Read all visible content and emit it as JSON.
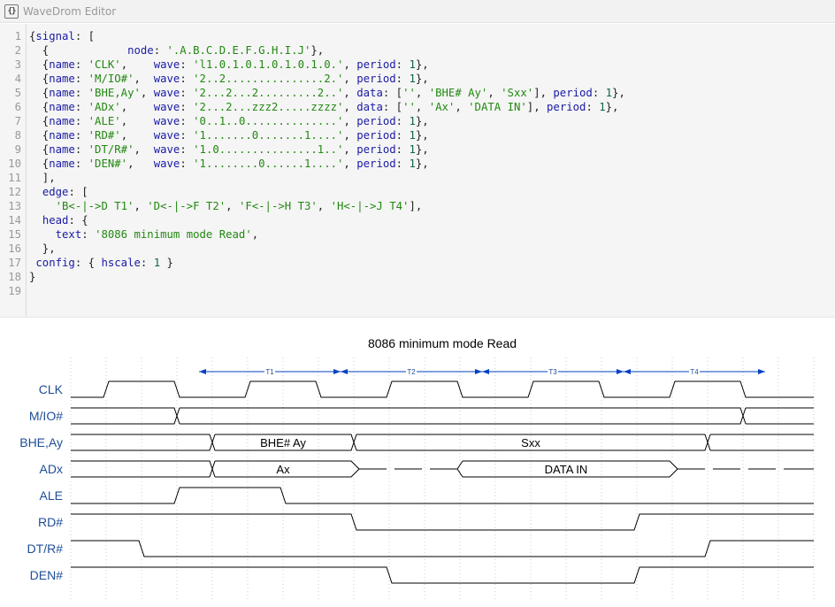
{
  "window": {
    "title": "WaveDrom Editor",
    "icon": "braces-icon"
  },
  "editor": {
    "line_numbers": [
      "1",
      "2",
      "3",
      "4",
      "5",
      "6",
      "7",
      "8",
      "9",
      "10",
      "11",
      "12",
      "13",
      "14",
      "15",
      "16",
      "17",
      "18",
      "19"
    ],
    "lines": [
      [
        {
          "t": "{",
          "c": "p"
        },
        {
          "t": "signal",
          "c": "key"
        },
        {
          "t": ": [",
          "c": "p"
        }
      ],
      [
        {
          "t": "  {            ",
          "c": "p"
        },
        {
          "t": "node",
          "c": "key"
        },
        {
          "t": ": ",
          "c": "p"
        },
        {
          "t": "'.A.B.C.D.E.F.G.H.I.J'",
          "c": "str"
        },
        {
          "t": "},",
          "c": "p"
        }
      ],
      [
        {
          "t": "  {",
          "c": "p"
        },
        {
          "t": "name",
          "c": "key"
        },
        {
          "t": ": ",
          "c": "p"
        },
        {
          "t": "'CLK'",
          "c": "str"
        },
        {
          "t": ",    ",
          "c": "p"
        },
        {
          "t": "wave",
          "c": "key"
        },
        {
          "t": ": ",
          "c": "p"
        },
        {
          "t": "'l1.0.1.0.1.0.1.0.1.0.'",
          "c": "str"
        },
        {
          "t": ", ",
          "c": "p"
        },
        {
          "t": "period",
          "c": "key"
        },
        {
          "t": ": ",
          "c": "p"
        },
        {
          "t": "1",
          "c": "num"
        },
        {
          "t": "},",
          "c": "p"
        }
      ],
      [
        {
          "t": "  {",
          "c": "p"
        },
        {
          "t": "name",
          "c": "key"
        },
        {
          "t": ": ",
          "c": "p"
        },
        {
          "t": "'M/IO#'",
          "c": "str"
        },
        {
          "t": ",  ",
          "c": "p"
        },
        {
          "t": "wave",
          "c": "key"
        },
        {
          "t": ": ",
          "c": "p"
        },
        {
          "t": "'2..2...............2.'",
          "c": "str"
        },
        {
          "t": ", ",
          "c": "p"
        },
        {
          "t": "period",
          "c": "key"
        },
        {
          "t": ": ",
          "c": "p"
        },
        {
          "t": "1",
          "c": "num"
        },
        {
          "t": "},",
          "c": "p"
        }
      ],
      [
        {
          "t": "  {",
          "c": "p"
        },
        {
          "t": "name",
          "c": "key"
        },
        {
          "t": ": ",
          "c": "p"
        },
        {
          "t": "'BHE,Ay'",
          "c": "str"
        },
        {
          "t": ", ",
          "c": "p"
        },
        {
          "t": "wave",
          "c": "key"
        },
        {
          "t": ": ",
          "c": "p"
        },
        {
          "t": "'2...2...2.........2..'",
          "c": "str"
        },
        {
          "t": ", ",
          "c": "p"
        },
        {
          "t": "data",
          "c": "key"
        },
        {
          "t": ": [",
          "c": "p"
        },
        {
          "t": "''",
          "c": "str"
        },
        {
          "t": ", ",
          "c": "p"
        },
        {
          "t": "'BHE# Ay'",
          "c": "str"
        },
        {
          "t": ", ",
          "c": "p"
        },
        {
          "t": "'Sxx'",
          "c": "str"
        },
        {
          "t": "], ",
          "c": "p"
        },
        {
          "t": "period",
          "c": "key"
        },
        {
          "t": ": ",
          "c": "p"
        },
        {
          "t": "1",
          "c": "num"
        },
        {
          "t": "},",
          "c": "p"
        }
      ],
      [
        {
          "t": "  {",
          "c": "p"
        },
        {
          "t": "name",
          "c": "key"
        },
        {
          "t": ": ",
          "c": "p"
        },
        {
          "t": "'ADx'",
          "c": "str"
        },
        {
          "t": ",    ",
          "c": "p"
        },
        {
          "t": "wave",
          "c": "key"
        },
        {
          "t": ": ",
          "c": "p"
        },
        {
          "t": "'2...2...zzz2.....zzzz'",
          "c": "str"
        },
        {
          "t": ", ",
          "c": "p"
        },
        {
          "t": "data",
          "c": "key"
        },
        {
          "t": ": [",
          "c": "p"
        },
        {
          "t": "''",
          "c": "str"
        },
        {
          "t": ", ",
          "c": "p"
        },
        {
          "t": "'Ax'",
          "c": "str"
        },
        {
          "t": ", ",
          "c": "p"
        },
        {
          "t": "'DATA IN'",
          "c": "str"
        },
        {
          "t": "], ",
          "c": "p"
        },
        {
          "t": "period",
          "c": "key"
        },
        {
          "t": ": ",
          "c": "p"
        },
        {
          "t": "1",
          "c": "num"
        },
        {
          "t": "},",
          "c": "p"
        }
      ],
      [
        {
          "t": "  {",
          "c": "p"
        },
        {
          "t": "name",
          "c": "key"
        },
        {
          "t": ": ",
          "c": "p"
        },
        {
          "t": "'ALE'",
          "c": "str"
        },
        {
          "t": ",    ",
          "c": "p"
        },
        {
          "t": "wave",
          "c": "key"
        },
        {
          "t": ": ",
          "c": "p"
        },
        {
          "t": "'0..1..0..............'",
          "c": "str"
        },
        {
          "t": ", ",
          "c": "p"
        },
        {
          "t": "period",
          "c": "key"
        },
        {
          "t": ": ",
          "c": "p"
        },
        {
          "t": "1",
          "c": "num"
        },
        {
          "t": "},",
          "c": "p"
        }
      ],
      [
        {
          "t": "  {",
          "c": "p"
        },
        {
          "t": "name",
          "c": "key"
        },
        {
          "t": ": ",
          "c": "p"
        },
        {
          "t": "'RD#'",
          "c": "str"
        },
        {
          "t": ",    ",
          "c": "p"
        },
        {
          "t": "wave",
          "c": "key"
        },
        {
          "t": ": ",
          "c": "p"
        },
        {
          "t": "'1.......0.......1....'",
          "c": "str"
        },
        {
          "t": ", ",
          "c": "p"
        },
        {
          "t": "period",
          "c": "key"
        },
        {
          "t": ": ",
          "c": "p"
        },
        {
          "t": "1",
          "c": "num"
        },
        {
          "t": "},",
          "c": "p"
        }
      ],
      [
        {
          "t": "  {",
          "c": "p"
        },
        {
          "t": "name",
          "c": "key"
        },
        {
          "t": ": ",
          "c": "p"
        },
        {
          "t": "'DT/R#'",
          "c": "str"
        },
        {
          "t": ",  ",
          "c": "p"
        },
        {
          "t": "wave",
          "c": "key"
        },
        {
          "t": ": ",
          "c": "p"
        },
        {
          "t": "'1.0...............1..'",
          "c": "str"
        },
        {
          "t": ", ",
          "c": "p"
        },
        {
          "t": "period",
          "c": "key"
        },
        {
          "t": ": ",
          "c": "p"
        },
        {
          "t": "1",
          "c": "num"
        },
        {
          "t": "},",
          "c": "p"
        }
      ],
      [
        {
          "t": "  {",
          "c": "p"
        },
        {
          "t": "name",
          "c": "key"
        },
        {
          "t": ": ",
          "c": "p"
        },
        {
          "t": "'DEN#'",
          "c": "str"
        },
        {
          "t": ",   ",
          "c": "p"
        },
        {
          "t": "wave",
          "c": "key"
        },
        {
          "t": ": ",
          "c": "p"
        },
        {
          "t": "'1........0......1....'",
          "c": "str"
        },
        {
          "t": ", ",
          "c": "p"
        },
        {
          "t": "period",
          "c": "key"
        },
        {
          "t": ": ",
          "c": "p"
        },
        {
          "t": "1",
          "c": "num"
        },
        {
          "t": "},",
          "c": "p"
        }
      ],
      [
        {
          "t": "  ],",
          "c": "p"
        }
      ],
      [
        {
          "t": "  ",
          "c": "p"
        },
        {
          "t": "edge",
          "c": "key"
        },
        {
          "t": ": [",
          "c": "p"
        }
      ],
      [
        {
          "t": "    ",
          "c": "p"
        },
        {
          "t": "'B<-|->D T1'",
          "c": "str"
        },
        {
          "t": ", ",
          "c": "p"
        },
        {
          "t": "'D<-|->F T2'",
          "c": "str"
        },
        {
          "t": ", ",
          "c": "p"
        },
        {
          "t": "'F<-|->H T3'",
          "c": "str"
        },
        {
          "t": ", ",
          "c": "p"
        },
        {
          "t": "'H<-|->J T4'",
          "c": "str"
        },
        {
          "t": "],",
          "c": "p"
        }
      ],
      [
        {
          "t": "  ",
          "c": "p"
        },
        {
          "t": "head",
          "c": "key"
        },
        {
          "t": ": {",
          "c": "p"
        }
      ],
      [
        {
          "t": "    ",
          "c": "p"
        },
        {
          "t": "text",
          "c": "key"
        },
        {
          "t": ": ",
          "c": "p"
        },
        {
          "t": "'8086 minimum mode Read'",
          "c": "str"
        },
        {
          "t": ",",
          "c": "p"
        }
      ],
      [
        {
          "t": "  },",
          "c": "p"
        }
      ],
      [
        {
          "t": " ",
          "c": "p"
        },
        {
          "t": "config",
          "c": "key"
        },
        {
          "t": ": { ",
          "c": "p"
        },
        {
          "t": "hscale",
          "c": "key"
        },
        {
          "t": ": ",
          "c": "p"
        },
        {
          "t": "1",
          "c": "num"
        },
        {
          "t": " }",
          "c": "p"
        }
      ],
      [
        {
          "t": "}",
          "c": "p"
        }
      ],
      []
    ]
  },
  "diagram": {
    "title": "8086 minimum mode Read",
    "colors": {
      "wave": "#000000",
      "label": "#1f4e96",
      "edge": "#0041c4",
      "grid": "#cccccc",
      "title": "#000000"
    },
    "signals": [
      {
        "name": "CLK",
        "wave": "l1.0.1.0.1.0.1.0.1.0.",
        "data": []
      },
      {
        "name": "M/IO#",
        "wave": "2..2...............2.",
        "data": []
      },
      {
        "name": "BHE,Ay",
        "wave": "2...2...2.........2..",
        "data": [
          "",
          "BHE# Ay",
          "Sxx"
        ]
      },
      {
        "name": "ADx",
        "wave": "2...2...zzz2.....zzzz",
        "data": [
          "",
          "Ax",
          "DATA IN"
        ]
      },
      {
        "name": "ALE",
        "wave": "0..1..0..............",
        "data": []
      },
      {
        "name": "RD#",
        "wave": "1.......0.......1....",
        "data": []
      },
      {
        "name": "DT/R#",
        "wave": "1.0...............1..",
        "data": []
      },
      {
        "name": "DEN#",
        "wave": "1........0......1....",
        "data": []
      }
    ],
    "node_string": ".A.B.C.D.E.F.G.H.I.J",
    "edges": [
      {
        "from": "B",
        "to": "D",
        "label": "T1"
      },
      {
        "from": "D",
        "to": "F",
        "label": "T2"
      },
      {
        "from": "F",
        "to": "H",
        "label": "T3"
      },
      {
        "from": "H",
        "to": "J",
        "label": "T4"
      }
    ]
  }
}
